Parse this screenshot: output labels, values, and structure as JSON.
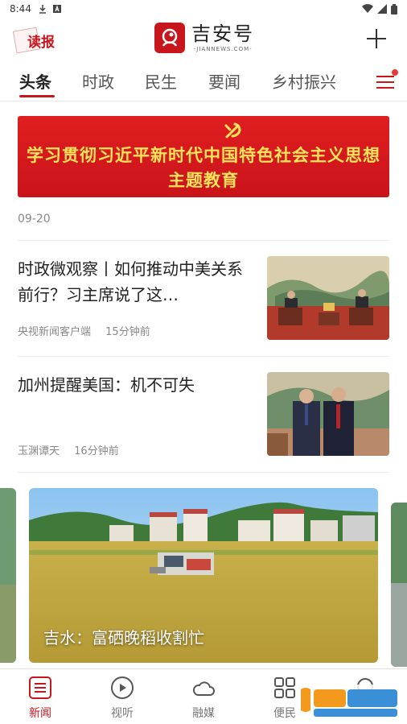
{
  "status_bar": {
    "time": "8:44",
    "icons_left": [
      "download-icon",
      "a-icon"
    ],
    "icons_right": [
      "wifi-icon",
      "signal-icon",
      "battery-icon"
    ]
  },
  "header": {
    "read_label": "读报",
    "brand_name": "吉安号",
    "brand_sub": "-JIANNEWS.COM-",
    "add_icon": "plus-icon"
  },
  "tabs": [
    {
      "label": "头条",
      "active": true
    },
    {
      "label": "时政",
      "active": false
    },
    {
      "label": "民生",
      "active": false
    },
    {
      "label": "要闻",
      "active": false
    },
    {
      "label": "乡村振兴",
      "active": false
    }
  ],
  "banner": {
    "line1": "学习贯彻习近平新时代中国特色社会主义思想",
    "line2": "主题教育"
  },
  "date": "09-20",
  "news": [
    {
      "title": "时政微观察丨如何推动中美关系前行？习主席说了这…",
      "source": "央视新闻客户端",
      "time": "15分钟前"
    },
    {
      "title": "加州提醒美国：机不可失",
      "source": "玉渊谭天",
      "time": "16分钟前"
    }
  ],
  "carousel": {
    "caption": "吉水：富硒晚稻收割忙"
  },
  "bottom_nav": [
    {
      "label": "新闻",
      "icon": "list-icon",
      "active": true
    },
    {
      "label": "视听",
      "icon": "play-icon",
      "active": false
    },
    {
      "label": "融媒",
      "icon": "cloud-icon",
      "active": false
    },
    {
      "label": "便民",
      "icon": "grid-icon",
      "active": false
    },
    {
      "label": "",
      "icon": "search-icon",
      "active": false
    }
  ],
  "colors": {
    "accent": "#c8161d",
    "banner_text": "#ffe35a"
  }
}
